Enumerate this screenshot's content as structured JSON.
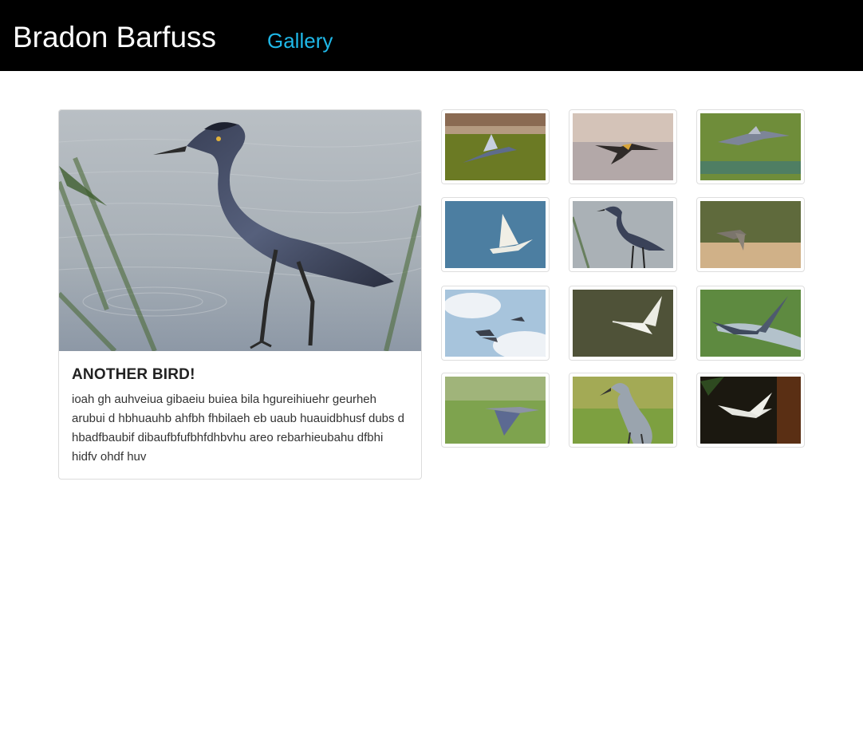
{
  "header": {
    "brand": "Bradon Barfuss",
    "nav_gallery": "Gallery"
  },
  "featured": {
    "title": "ANOTHER BIRD!",
    "description": "ioah gh auhveiua gibaeiu buiea bila hgureihiuehr geurheh arubui d hbhuauhb ahfbh fhbilaeh eb uaub huauidbhusf dubs d hbadfbaubif dibaufbfufbhfdhbvhu areo rebarhieubahu dfbhi hidfv ohdf huv"
  },
  "colors": {
    "navbar_bg": "#000000",
    "brand_text": "#ffffff",
    "nav_link": "#1fb8e8"
  }
}
